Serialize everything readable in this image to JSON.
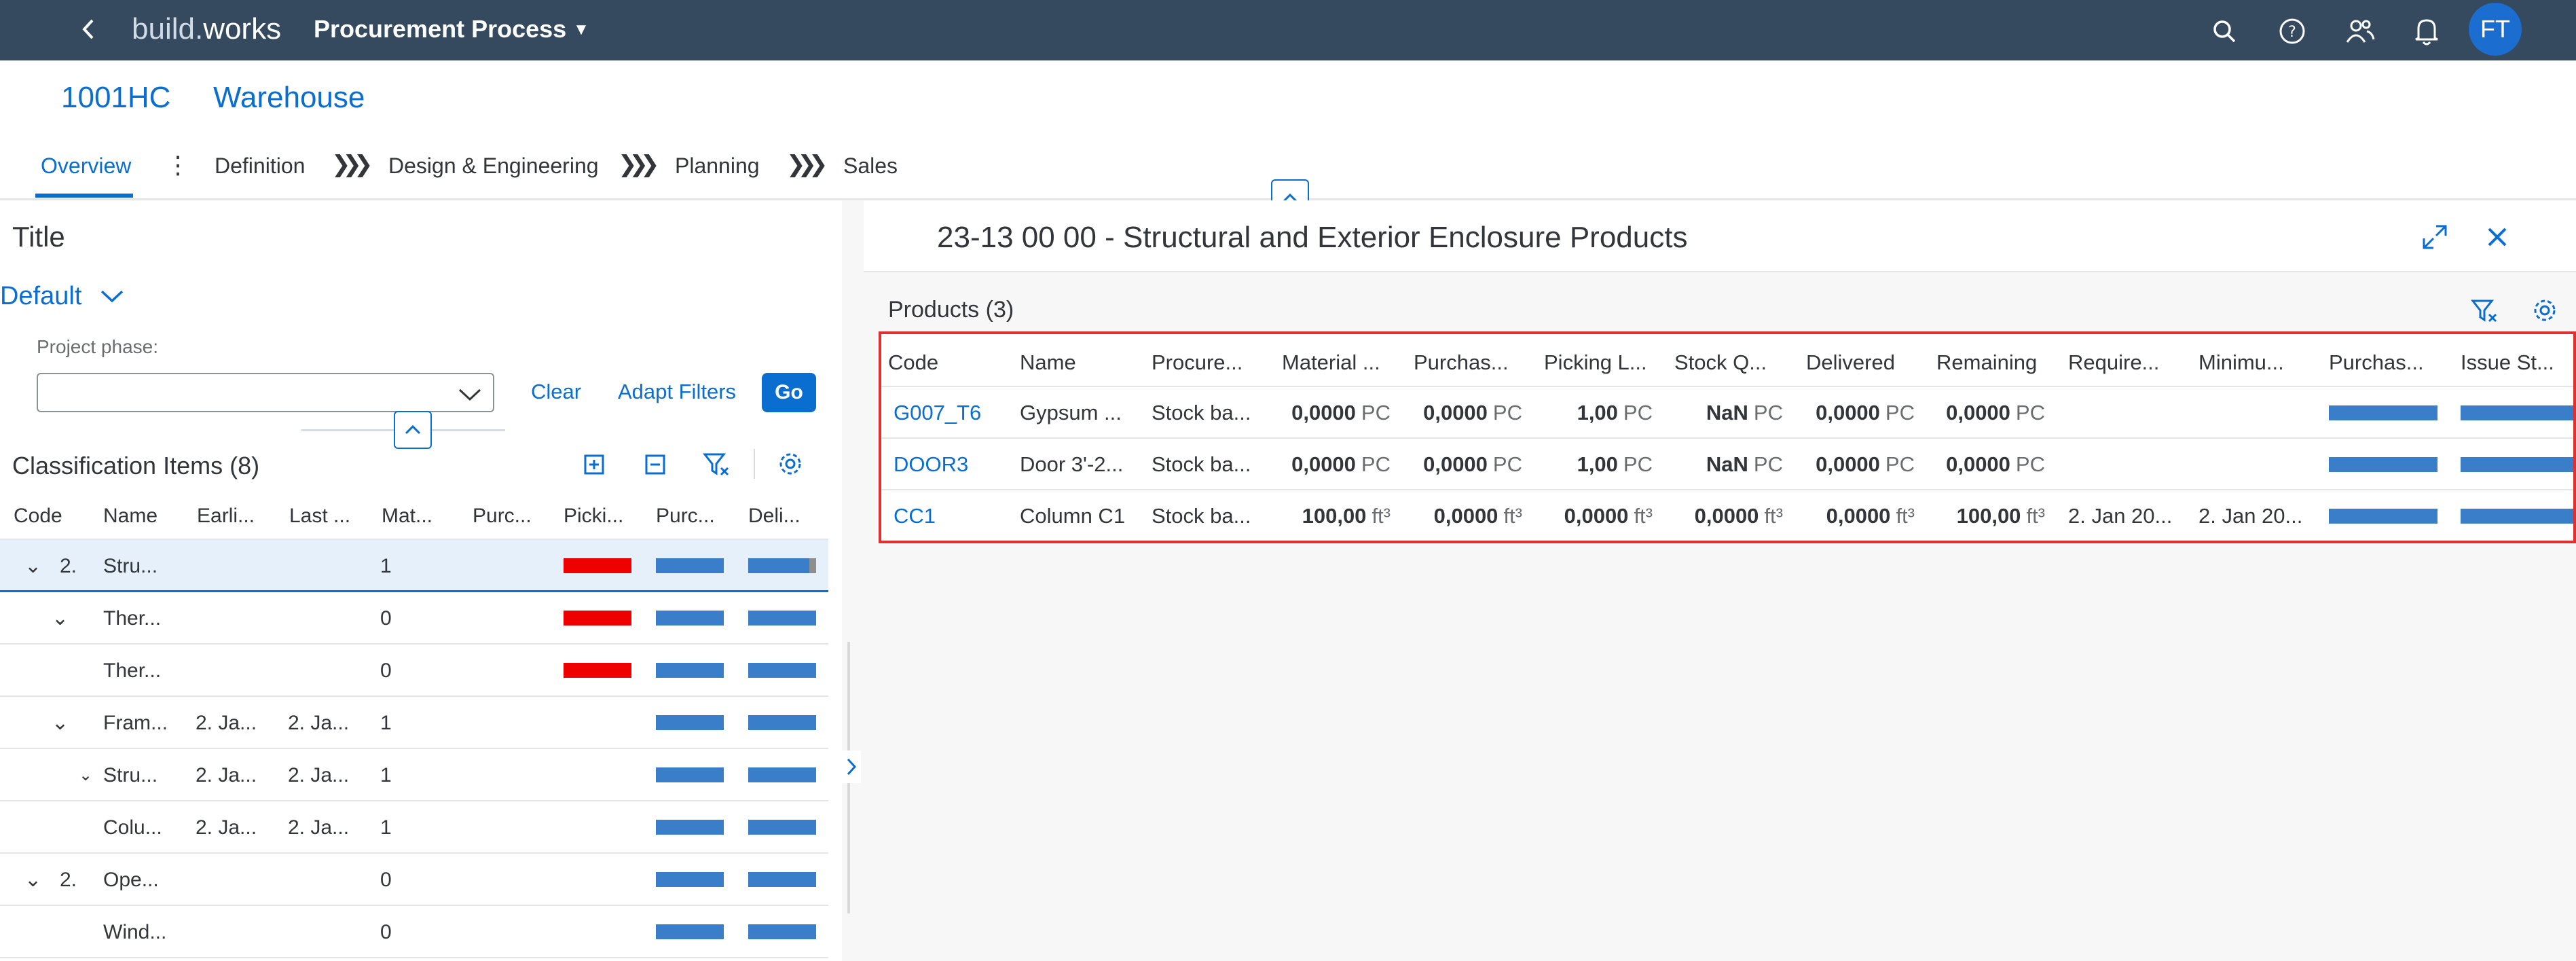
{
  "shell": {
    "brand_prefix": "build.",
    "brand_suffix": "works",
    "app_title": "Procurement Process",
    "avatar_initials": "FT",
    "icons": [
      "back-icon",
      "search-icon",
      "help-icon",
      "people-icon",
      "bell-icon"
    ]
  },
  "object": {
    "id": "1001HC",
    "name": "Warehouse",
    "tabs": [
      "Overview",
      "Definition",
      "Design & Engineering",
      "Planning",
      "Sales"
    ]
  },
  "left": {
    "title": "Title",
    "variant": "Default",
    "filter_label": "Project phase:",
    "filter_value": "",
    "clear": "Clear",
    "adapt_filters": "Adapt Filters",
    "go": "Go",
    "table_title": "Classification Items (8)",
    "columns": [
      "Code",
      "Name",
      "Earli...",
      "Last ...",
      "Mat...",
      "Purc...",
      "Picki...",
      "Purc...",
      "Deli..."
    ],
    "rows": [
      {
        "code": "2.",
        "expand": "v",
        "name": "Stru...",
        "earliest": "",
        "last": "",
        "mat": "1",
        "picking": "red"
      },
      {
        "code": "",
        "expand": "v",
        "name": "Ther...",
        "earliest": "",
        "last": "",
        "mat": "0",
        "picking": "red"
      },
      {
        "code": "",
        "expand": "",
        "name": "Ther...",
        "earliest": "",
        "last": "",
        "mat": "0",
        "picking": "red"
      },
      {
        "code": "",
        "expand": "v",
        "name": "Fram...",
        "earliest": "2. Ja...",
        "last": "2. Ja...",
        "mat": "1",
        "picking": ""
      },
      {
        "code": "",
        "expand": "v",
        "name": "Stru...",
        "earliest": "2. Ja...",
        "last": "2. Ja...",
        "mat": "1",
        "picking": ""
      },
      {
        "code": "",
        "expand": "",
        "name": "Colu...",
        "earliest": "2. Ja...",
        "last": "2. Ja...",
        "mat": "1",
        "picking": ""
      },
      {
        "code": "2.",
        "expand": "v",
        "name": "Ope...",
        "earliest": "",
        "last": "",
        "mat": "0",
        "picking": ""
      },
      {
        "code": "",
        "expand": "",
        "name": "Wind...",
        "earliest": "",
        "last": "",
        "mat": "0",
        "picking": ""
      }
    ]
  },
  "right": {
    "title": "23-13 00 00 - Structural and Exterior Enclosure Products",
    "products_title": "Products (3)",
    "columns": [
      "Code",
      "Name",
      "Procure...",
      "Material ...",
      "Purchas...",
      "Picking L...",
      "Stock Q...",
      "Delivered",
      "Remaining",
      "Require...",
      "Minimu...",
      "Purchas...",
      "Issue St..."
    ],
    "rows": [
      {
        "code": "G007_T6",
        "name": "Gypsum ...",
        "procure": "Stock ba...",
        "material": "0,0000",
        "purchas": "0,0000",
        "picking": "1,00",
        "stock": "NaN",
        "delivered": "0,0000",
        "remaining": "0,0000",
        "unit": "PC",
        "require": "",
        "minimum": ""
      },
      {
        "code": "DOOR3",
        "name": "Door 3'-2...",
        "procure": "Stock ba...",
        "material": "0,0000",
        "purchas": "0,0000",
        "picking": "1,00",
        "stock": "NaN",
        "delivered": "0,0000",
        "remaining": "0,0000",
        "unit": "PC",
        "require": "",
        "minimum": ""
      },
      {
        "code": "CC1",
        "name": "Column C1",
        "procure": "Stock ba...",
        "material": "100,00",
        "purchas": "0,0000",
        "picking": "0,0000",
        "stock": "0,0000",
        "delivered": "0,0000",
        "remaining": "100,00",
        "unit": "ft³",
        "require": "2. Jan 20...",
        "minimum": "2. Jan 20..."
      }
    ]
  },
  "colors": {
    "shell": "#354a5f",
    "accent": "#0a6ed1",
    "bar_red": "#ee0000",
    "bar_blue": "#3a7dc9",
    "highlight": "#e03131"
  }
}
